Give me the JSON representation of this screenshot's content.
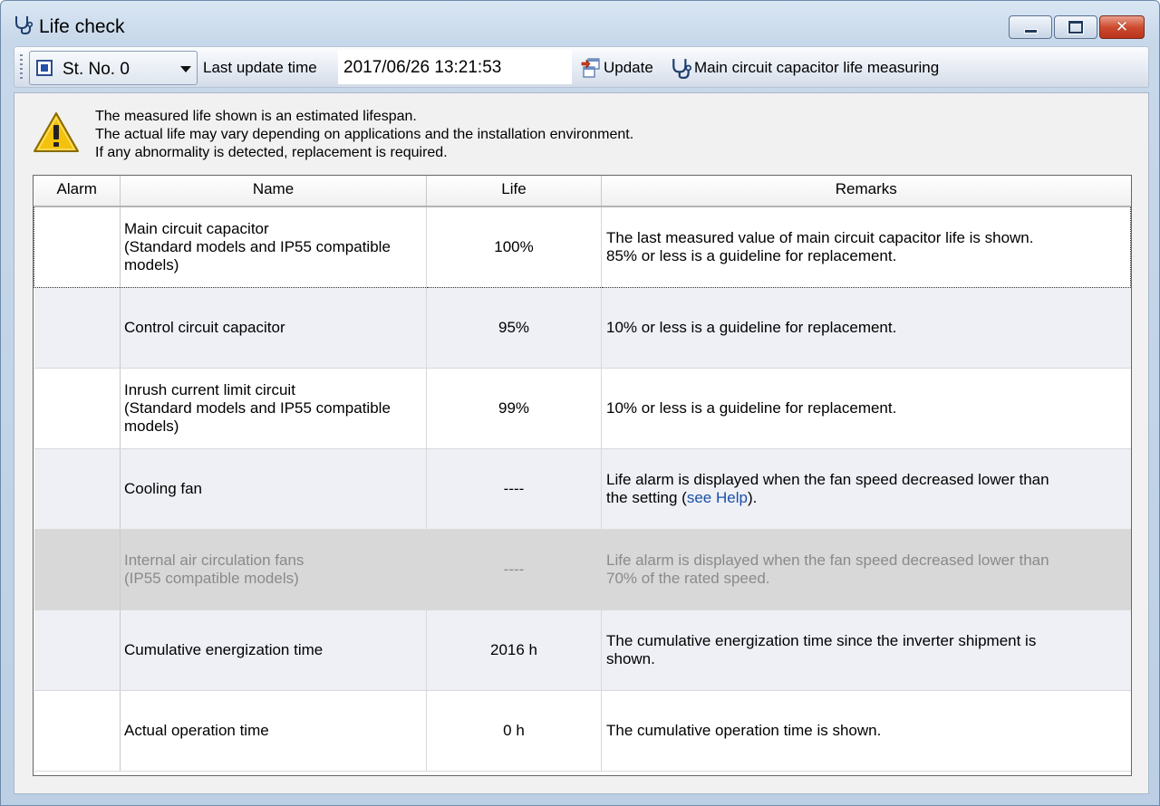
{
  "window": {
    "title": "Life check",
    "title_icon": "stethoscope-icon",
    "controls": [
      "minimize-icon",
      "maximize-icon",
      "close-icon"
    ]
  },
  "toolbar": {
    "station_label": "St. No. 0",
    "last_update_label": "Last update time",
    "last_update_value": "2017/06/26 13:21:53",
    "update_label": "Update",
    "measure_label": "Main circuit capacitor life measuring"
  },
  "notice": {
    "icon": "warning-icon",
    "lines": [
      "The measured life shown is an estimated lifespan.",
      "The actual life may vary depending on applications and the installation environment.",
      "If any abnormality is detected, replacement is required."
    ]
  },
  "table": {
    "headers": [
      "Alarm",
      "Name",
      "Life",
      "Remarks"
    ],
    "rows": [
      {
        "alarm": "",
        "name_lines": [
          "Main circuit capacitor",
          "(Standard models and IP55 compatible",
          "models)"
        ],
        "life": "100%",
        "remarks_lines": [
          "The last measured value of main circuit capacitor life is shown.",
          "85% or less is a guideline for replacement."
        ]
      },
      {
        "alarm": "",
        "name_lines": [
          "Control circuit capacitor"
        ],
        "life": "95%",
        "remarks_lines": [
          "10% or less is a guideline for replacement."
        ]
      },
      {
        "alarm": "",
        "name_lines": [
          "Inrush current limit circuit",
          "(Standard models and IP55 compatible",
          "models)"
        ],
        "life": "99%",
        "remarks_lines": [
          "10% or less is a guideline for replacement."
        ]
      },
      {
        "alarm": "",
        "name_lines": [
          "Cooling fan"
        ],
        "life": "----",
        "remarks_lines": [
          "Life alarm is displayed when the fan speed decreased lower than"
        ],
        "remarks_pre": "the setting (",
        "remarks_link": "see Help",
        "remarks_post": ")."
      },
      {
        "alarm": "",
        "name_lines": [
          "Internal air circulation fans",
          "(IP55 compatible models)"
        ],
        "life": "----",
        "remarks_lines": [
          "Life alarm is displayed when the fan speed decreased lower than",
          "70% of the rated speed."
        ]
      },
      {
        "alarm": "",
        "name_lines": [
          "Cumulative energization time"
        ],
        "life": "2016 h",
        "remarks_lines": [
          "The cumulative energization time since the inverter shipment is",
          "shown."
        ]
      },
      {
        "alarm": "",
        "name_lines": [
          "Actual operation time"
        ],
        "life": "0 h",
        "remarks_lines": [
          "The cumulative operation time is shown."
        ]
      }
    ]
  }
}
